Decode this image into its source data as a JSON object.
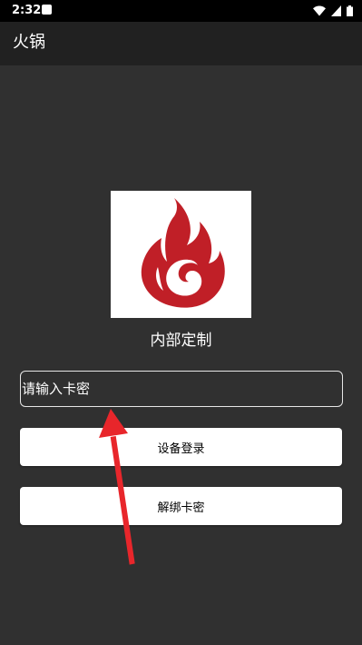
{
  "status_bar": {
    "time": "2:32",
    "icons": [
      "notification-icon",
      "wifi-icon",
      "cellular-signal-icon",
      "battery-icon"
    ]
  },
  "app_bar": {
    "title": "火锅"
  },
  "main": {
    "logo_icon": "flame-logo-icon",
    "subtitle": "内部定制",
    "card_input": {
      "placeholder": "请输入卡密",
      "value": ""
    },
    "device_login_label": "设备登录",
    "unbind_label": "解绑卡密"
  },
  "annotation": {
    "icon": "red-arrow-icon",
    "color": "#e8262b"
  },
  "colors": {
    "background": "#303030",
    "app_bar": "#212121",
    "status_bar": "#000000",
    "logo_red": "#c01f27",
    "button_bg": "#ffffff"
  }
}
